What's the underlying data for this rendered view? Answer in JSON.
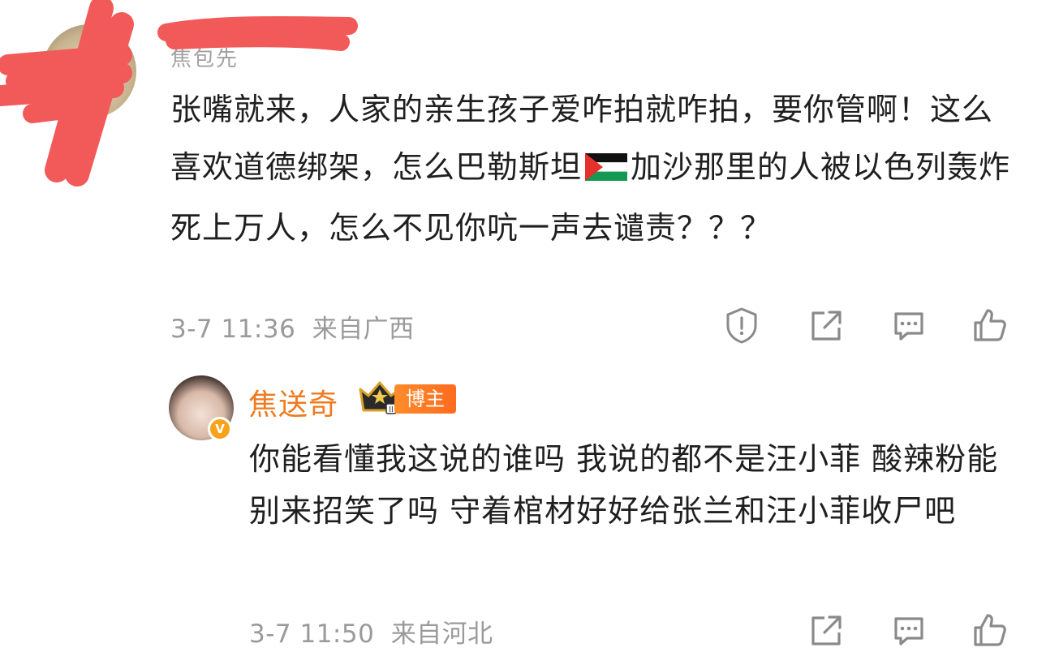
{
  "comment1": {
    "author": "焦包先",
    "text_before_flag": "张嘴就来，人家的亲生孩子爱咋拍就咋拍，要你管啊！这么喜欢道德绑架，怎么巴勒斯坦",
    "flag": "palestine-flag-emoji",
    "text_after_flag": "加沙那里的人被以色列轰炸死上万人，怎么不见你吭一声去谴责？？？",
    "time": "3-7 11:36",
    "location": "来自广西",
    "actions": [
      "report-icon",
      "share-icon",
      "comment-icon",
      "like-icon"
    ]
  },
  "reply": {
    "author": "焦送奇",
    "badge": "博主",
    "verified": "V",
    "text": "你能看懂我这说的谁吗 我说的都不是汪小菲 酸辣粉能别来招笑了吗 守着棺材好好给张兰和汪小菲收尸吧",
    "time": "3-7 11:50",
    "location": "来自河北",
    "actions": [
      "share-icon",
      "comment-icon",
      "like-icon"
    ]
  },
  "colors": {
    "author_highlight": "#f07a1e",
    "meta_gray": "#9a9a9a",
    "redaction": "#f25a5a"
  }
}
